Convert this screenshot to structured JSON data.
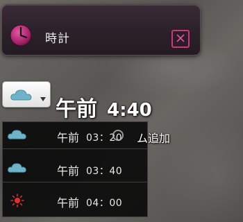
{
  "window": {
    "title": "時計",
    "title_icon": "clock-icon",
    "close_icon": "close-icon",
    "accent_color": "#d2357f"
  },
  "current": {
    "weather_icon": "cloud-icon",
    "ampm": "午前",
    "time": "4:40"
  },
  "alarm_label": "ム追加",
  "schedule": [
    {
      "icon": "cloud-icon",
      "ampm": "午前",
      "time": "03：20"
    },
    {
      "icon": "cloud-icon",
      "ampm": "午前",
      "time": "03：40"
    },
    {
      "icon": "sun-icon",
      "ampm": "午前",
      "time": "04：00"
    }
  ]
}
